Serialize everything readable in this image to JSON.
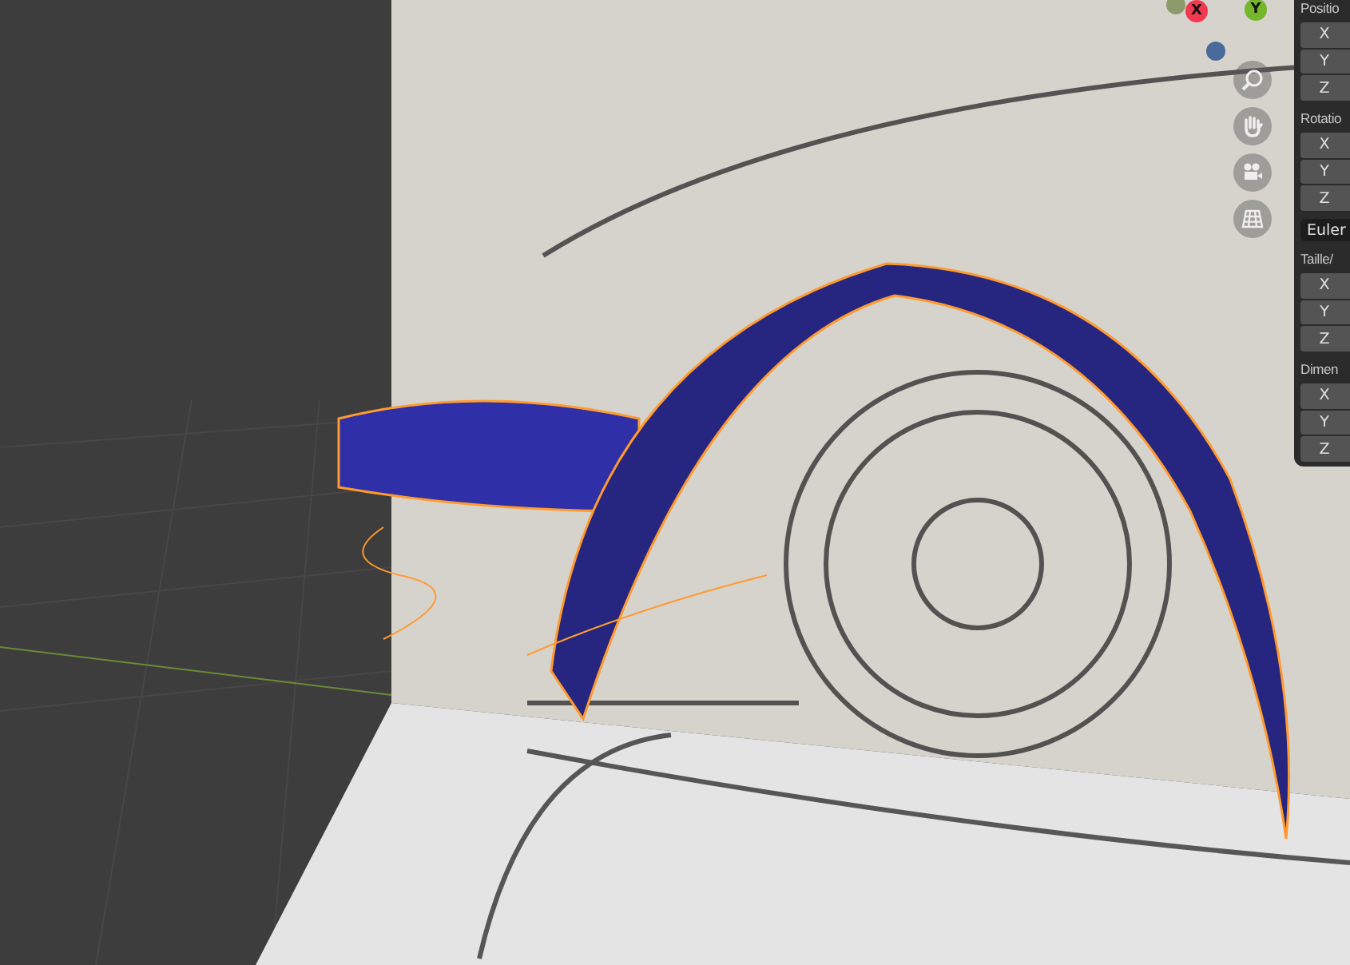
{
  "viewport": {
    "axis_gizmo": [
      {
        "label": "X",
        "color": "#f0394f"
      },
      {
        "label": "Y",
        "color": "#74b72a"
      }
    ]
  },
  "properties_panel": {
    "sections": [
      {
        "label": "Positio",
        "fields": [
          "X",
          "Y",
          "Z"
        ]
      },
      {
        "label": "Rotatio",
        "fields": [
          "X",
          "Y",
          "Z"
        ],
        "mode": "Euler"
      },
      {
        "label": "Taille/",
        "fields": [
          "X",
          "Y",
          "Z"
        ]
      },
      {
        "label": "Dimen",
        "fields": [
          "X",
          "Y",
          "Z"
        ]
      }
    ]
  }
}
